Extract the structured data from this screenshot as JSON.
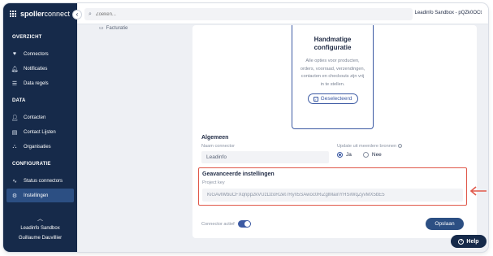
{
  "brand": {
    "name_a": "spoller",
    "name_b": "connect"
  },
  "search": {
    "placeholder": "Zoeken..."
  },
  "account": {
    "label": "Leadinfo Sandbox - pQZk0OCt"
  },
  "sidebar": {
    "sections": [
      {
        "title": "OVERZICHT",
        "items": [
          {
            "label": "Connectors",
            "icon": "heart-icon"
          },
          {
            "label": "Notificaties",
            "icon": "bell-icon"
          },
          {
            "label": "Data regels",
            "icon": "list-icon"
          }
        ]
      },
      {
        "title": "DATA",
        "items": [
          {
            "label": "Contacten",
            "icon": "user-icon"
          },
          {
            "label": "Contact Lijsten",
            "icon": "contact-list-icon"
          },
          {
            "label": "Organisaties",
            "icon": "organisation-icon"
          }
        ]
      },
      {
        "title": "CONFIGURATIE",
        "items": [
          {
            "label": "Status connectors",
            "icon": "pulse-icon"
          },
          {
            "label": "Instellingen",
            "icon": "gear-icon",
            "active": true
          }
        ]
      }
    ],
    "footer": {
      "org": "Leadinfo Sandbox",
      "user": "Guillaume Dauvillier"
    }
  },
  "breadcrumb": {
    "label": "Facturatie"
  },
  "config_tile": {
    "title_line1": "Handmatige",
    "title_line2": "configuratie",
    "description": "Alle opties voor producten, orders, voorraad, verzendingen, contacten en checkouts zijn vrij in te stellen.",
    "button": "Geselecteerd"
  },
  "general": {
    "heading": "Algemeen",
    "name_label": "Naam connector",
    "name_value": "Leadinfo",
    "update_label": "Update uit meerdere bronnen",
    "option_yes": "Ja",
    "option_no": "Nee",
    "selected": "Ja"
  },
  "advanced": {
    "heading": "Geavanceerde instellingen",
    "key_label": "Project key",
    "key_value": "KiGAvlWbuCFXqnpp2kVUzDzoR2et7Ryn5SAwoc0RiZglMainYHSiWqZyvMX5bE5"
  },
  "footer": {
    "toggle_label": "Connector actief",
    "toggle_on": true,
    "save": "Opslaan"
  },
  "help": {
    "label": "Help"
  },
  "colors": {
    "sidebar": "#162a4a",
    "accent": "#3c5aa3",
    "highlight": "#e0584a"
  }
}
